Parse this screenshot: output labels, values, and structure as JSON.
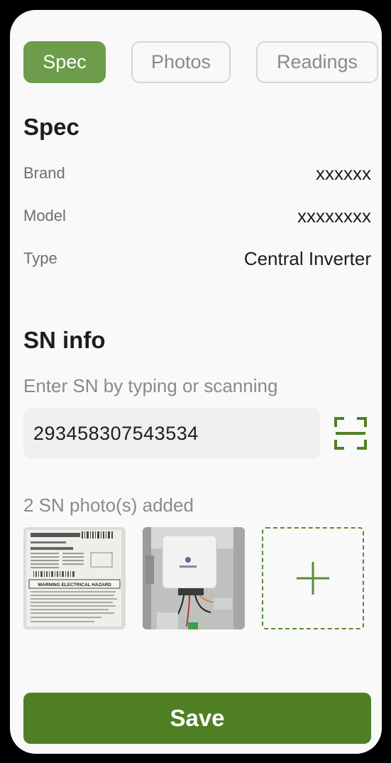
{
  "tabs": [
    {
      "label": "Spec",
      "active": true
    },
    {
      "label": "Photos",
      "active": false
    },
    {
      "label": "Readings",
      "active": false
    }
  ],
  "spec": {
    "title": "Spec",
    "rows": [
      {
        "label": "Brand",
        "value": "xxxxxx"
      },
      {
        "label": "Model",
        "value": "xxxxxxxx"
      },
      {
        "label": "Type",
        "value": "Central Inverter"
      }
    ]
  },
  "sn_info": {
    "title": "SN info",
    "hint": "Enter SN by typing or scanning",
    "sn_value": "293458307543534",
    "photos_count_text": "2 SN photo(s) added",
    "photos": [
      {
        "icon": "label-sticker-photo",
        "label_lines": [
          "WARNING ELECTRICAL HAZARD"
        ]
      },
      {
        "icon": "inverter-photo"
      }
    ],
    "add_icon": "plus-icon",
    "scan_icon": "scan-icon"
  },
  "save_label": "Save",
  "colors": {
    "accent": "#6d9c4a",
    "save": "#4f7f23",
    "background": "#f9f9f9",
    "input": "#efefef"
  }
}
